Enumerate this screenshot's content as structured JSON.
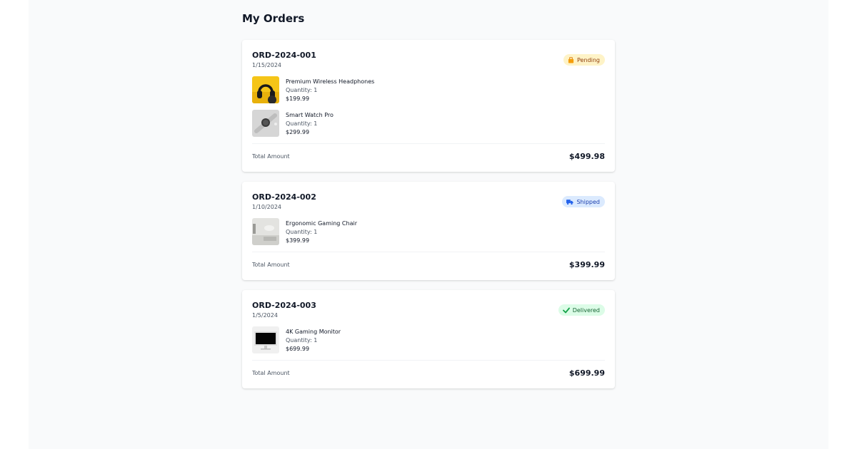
{
  "page": {
    "title": "My Orders"
  },
  "orders": [
    {
      "id": "ORD-2024-001",
      "date": "1/15/2024",
      "status": "Pending",
      "status_icon": "box-icon",
      "status_color": "#92400e",
      "status_bg": "#fef3c7",
      "items": [
        {
          "name": "Premium Wireless Headphones",
          "quantity": "Quantity: 1",
          "price": "$199.99",
          "image_icon": "headphones-image"
        },
        {
          "name": "Smart Watch Pro",
          "quantity": "Quantity: 1",
          "price": "$299.99",
          "image_icon": "smart-watch-image"
        }
      ],
      "total_label": "Total Amount",
      "total": "$499.98"
    },
    {
      "id": "ORD-2024-002",
      "date": "1/10/2024",
      "status": "Shipped",
      "status_icon": "truck-icon",
      "status_color": "#1e40af",
      "status_bg": "#dbeafe",
      "items": [
        {
          "name": "Ergonomic Gaming Chair",
          "quantity": "Quantity: 1",
          "price": "$399.99",
          "image_icon": "gaming-chair-image"
        }
      ],
      "total_label": "Total Amount",
      "total": "$399.99"
    },
    {
      "id": "ORD-2024-003",
      "date": "1/5/2024",
      "status": "Delivered",
      "status_icon": "check-icon",
      "status_color": "#166534",
      "status_bg": "#dcfce7",
      "items": [
        {
          "name": "4K Gaming Monitor",
          "quantity": "Quantity: 1",
          "price": "$699.99",
          "image_icon": "monitor-image"
        }
      ],
      "total_label": "Total Amount",
      "total": "$699.99"
    }
  ]
}
